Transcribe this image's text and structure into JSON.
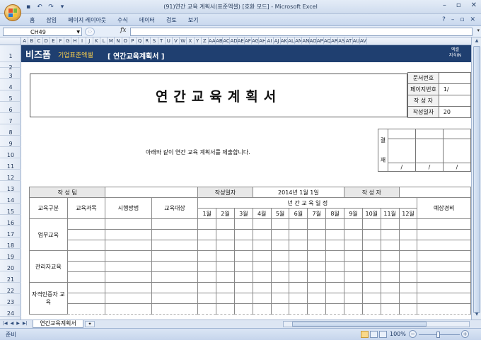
{
  "window": {
    "title": "(91)연간 교육 계획서(표준엑셀) [호환 모드] - Microsoft Excel"
  },
  "ribbon": {
    "tabs": [
      "홈",
      "삽입",
      "페이지 레이아웃",
      "수식",
      "데이터",
      "검토",
      "보기"
    ]
  },
  "formula_bar": {
    "name_box": "CH49",
    "fx_label": "fx",
    "content": ""
  },
  "column_letters": [
    "A",
    "B",
    "C",
    "D",
    "E",
    "F",
    "G",
    "H",
    "I",
    "J",
    "K",
    "L",
    "M",
    "N",
    "O",
    "P",
    "Q",
    "R",
    "S",
    "T",
    "U",
    "V",
    "W",
    "X",
    "Y",
    "Z",
    "AA",
    "AB",
    "AC",
    "AD",
    "AE",
    "AF",
    "AG",
    "AH",
    "AI",
    "AJ",
    "AK",
    "AL",
    "AM",
    "AN",
    "AO",
    "AP",
    "AQ",
    "AR",
    "AS",
    "AT",
    "AU",
    "AV"
  ],
  "row_numbers": [
    "1",
    "2",
    "3",
    "4",
    "5",
    "6",
    "7",
    "8",
    "9",
    "10",
    "11",
    "12",
    "13",
    "14",
    "15",
    "16",
    "17",
    "18",
    "19",
    "20",
    "21",
    "22",
    "23",
    "24"
  ],
  "brand": {
    "name": "비즈폼",
    "subtitle": "기업표준엑셀",
    "sheet_title": "[ 연간교육계획서 ]",
    "right_line1": "엑셀",
    "right_line2": "지식IN"
  },
  "document": {
    "title": "연간교육계획서",
    "info": [
      {
        "label": "문서번호",
        "value": ""
      },
      {
        "label": "페이지번호",
        "value": "1/"
      },
      {
        "label": "작 성 자",
        "value": ""
      },
      {
        "label": "작성일자",
        "value": "20"
      }
    ],
    "notice": "아래와 같이 연간 교육 계획서를 제출합니다.",
    "approval": {
      "label_top": "결",
      "label_bottom": "재",
      "date_marks": [
        "/",
        "/",
        "/"
      ]
    }
  },
  "plan_table": {
    "team_label": "작 성 팀",
    "team_value": "",
    "date_label": "작성일자",
    "date_value": "2014년 1월 1일",
    "writer_label": "작 성 자",
    "writer_value": "",
    "schedule_label": "년 간 교 육 일 정",
    "columns": {
      "category": "교육구분",
      "course": "교육과목",
      "method": "시행방법",
      "target": "교육대상",
      "cost": "예상경비"
    },
    "months": [
      "1월",
      "2월",
      "3월",
      "4월",
      "5월",
      "6월",
      "7월",
      "8월",
      "9월",
      "10월",
      "11월",
      "12월"
    ],
    "categories": [
      "업무교육",
      "관리자교육",
      "자격인증자 교육"
    ]
  },
  "sheet_tabs": {
    "active": "연간교육계획서"
  },
  "status": {
    "ready": "준비",
    "zoom": "100%"
  }
}
